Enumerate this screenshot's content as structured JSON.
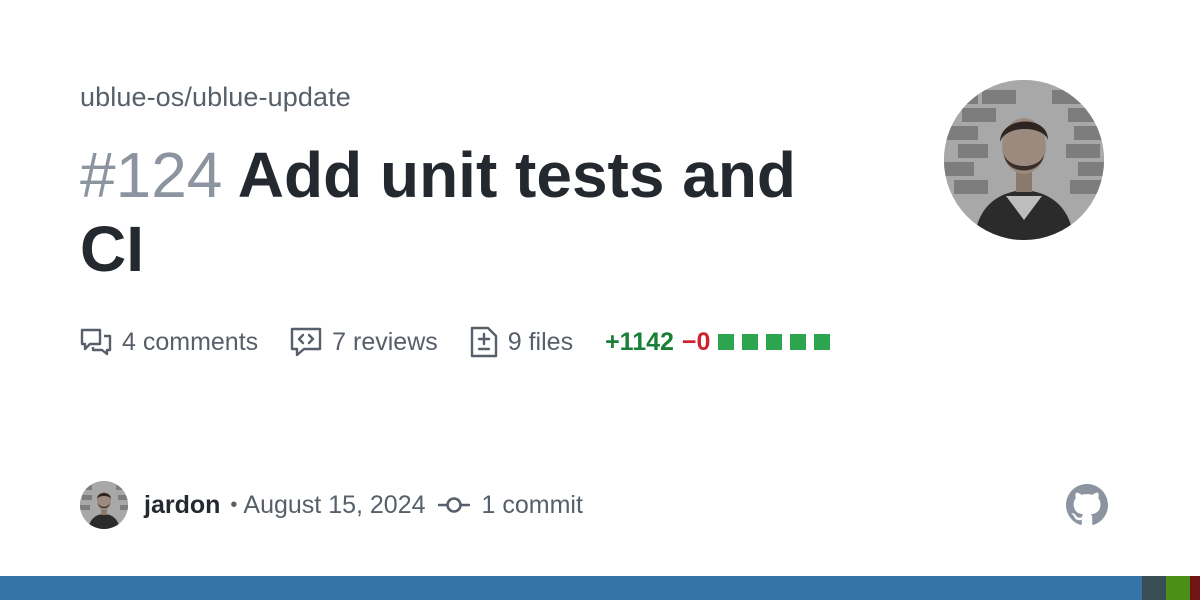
{
  "repo": {
    "name": "ublue-os/ublue-update"
  },
  "pr": {
    "number": "#124",
    "title": "Add unit tests and CI"
  },
  "stats": {
    "comments": "4 comments",
    "reviews": "7 reviews",
    "files": "9 files"
  },
  "diff": {
    "additions": "+1142",
    "deletions": "−0",
    "blocks": 5,
    "add_color": "#2da44e"
  },
  "footer": {
    "author": "jardon",
    "separator": "•",
    "date": "August 15, 2024",
    "commits": "1 commit"
  },
  "icons": {
    "comments": "comment-discussion-icon",
    "reviews": "code-review-icon",
    "files": "file-diff-icon",
    "commit": "git-commit-icon",
    "brand": "github-mark-icon"
  },
  "colors": {
    "title": "#24292f",
    "muted": "#57606a",
    "number": "#8c959f",
    "additions": "#1a7f37",
    "deletions": "#cf222e",
    "language_bar": [
      "#3572A5",
      "#384d54",
      "#4c8f18",
      "#701516"
    ]
  }
}
